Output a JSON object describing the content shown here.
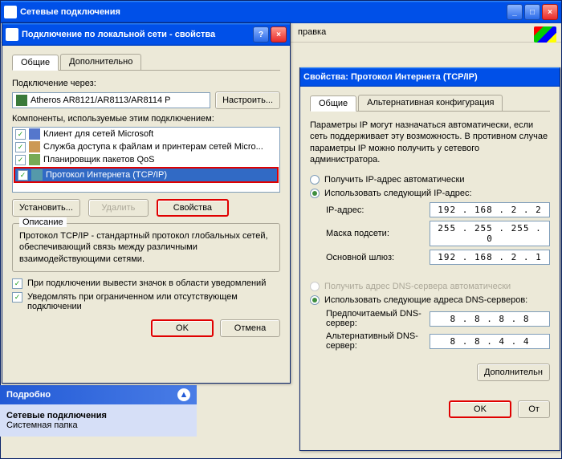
{
  "backWindow": {
    "title": "Сетевые подключения",
    "menu": "правка",
    "task": {
      "header": "Подробно",
      "title": "Сетевые подключения",
      "sub": "Системная папка",
      "expand": "▲"
    }
  },
  "propsWindow": {
    "title": "Подключение по локальной сети - свойства",
    "help": "?",
    "close": "×",
    "tabs": [
      "Общие",
      "Дополнительно"
    ],
    "connectUsing": "Подключение через:",
    "adapter": "Atheros AR8121/AR8113/AR8114 P",
    "configure": "Настроить...",
    "componentsLabel": "Компоненты, используемые этим подключением:",
    "components": [
      {
        "label": "Клиент для сетей Microsoft",
        "checked": true,
        "sel": false
      },
      {
        "label": "Служба доступа к файлам и принтерам сетей Micro...",
        "checked": true,
        "sel": false
      },
      {
        "label": "Планировщик пакетов QoS",
        "checked": true,
        "sel": false
      },
      {
        "label": "Протокол Интернета (TCP/IP)",
        "checked": true,
        "sel": true
      }
    ],
    "install": "Установить...",
    "uninstall": "Удалить",
    "properties": "Свойства",
    "descGroup": "Описание",
    "descText": "Протокол TCP/IP - стандартный протокол глобальных сетей, обеспечивающий связь между различными взаимодействующими сетями.",
    "chk1": "При подключении вывести значок в области уведомлений",
    "chk2": "Уведомлять при ограниченном или отсутствующем подключении",
    "ok": "OK",
    "cancel": "Отмена"
  },
  "tcpipWindow": {
    "title": "Свойства: Протокол Интернета (TCP/IP)",
    "tabs": [
      "Общие",
      "Альтернативная конфигурация"
    ],
    "intro": "Параметры IP могут назначаться автоматически, если сеть поддерживает эту возможность. В противном случае параметры IP можно получить у сетевого администратора.",
    "radioIpAuto": "Получить IP-адрес автоматически",
    "radioIpManual": "Использовать следующий IP-адрес:",
    "ipLabel": "IP-адрес:",
    "ipVal": "192 . 168 .  2  .  2",
    "maskLabel": "Маска подсети:",
    "maskVal": "255 . 255 . 255 .  0",
    "gwLabel": "Основной шлюз:",
    "gwVal": "192 . 168 .  2  .  1",
    "radioDnsAuto": "Получить адрес DNS-сервера автоматически",
    "radioDnsManual": "Использовать следующие адреса DNS-серверов:",
    "dns1Label": "Предпочитаемый DNS-сервер:",
    "dns1Val": "8  .  8  .  8  .  8",
    "dns2Label": "Альтернативный DNS-сервер:",
    "dns2Val": "8  .  8  .  4  .  4",
    "advanced": "Дополнительн",
    "ok": "OK",
    "cancel": "От"
  }
}
